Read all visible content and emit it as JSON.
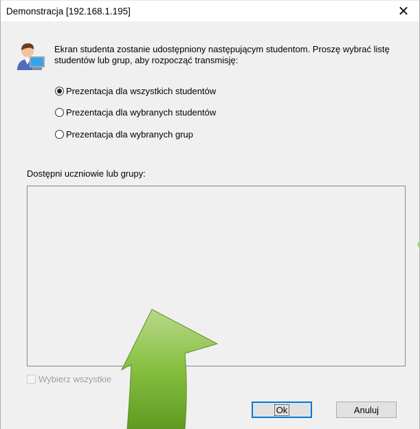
{
  "window": {
    "title": "Demonstracja [192.168.1.195]",
    "close_glyph": "✕"
  },
  "info": {
    "icon": "student-computer-icon",
    "text": "Ekran studenta zostanie udostępniony następującym studentom. Proszę wybrać listę studentów lub grup, aby rozpocząć transmisję:"
  },
  "options": [
    {
      "label": "Prezentacja dla wszystkich studentów",
      "checked": true
    },
    {
      "label": "Prezentacja dla wybranych studentów",
      "checked": false
    },
    {
      "label": "Prezentacja dla wybranych grup",
      "checked": false
    }
  ],
  "list": {
    "label": "Dostępni uczniowie lub grupy:",
    "items": []
  },
  "select_all": {
    "label": "Wybierz wszystkie",
    "checked": false,
    "enabled": false
  },
  "buttons": {
    "ok": "Ok",
    "cancel": "Anuluj"
  },
  "colors": {
    "arrow": "#7fb83a",
    "accent": "#0078d7"
  }
}
